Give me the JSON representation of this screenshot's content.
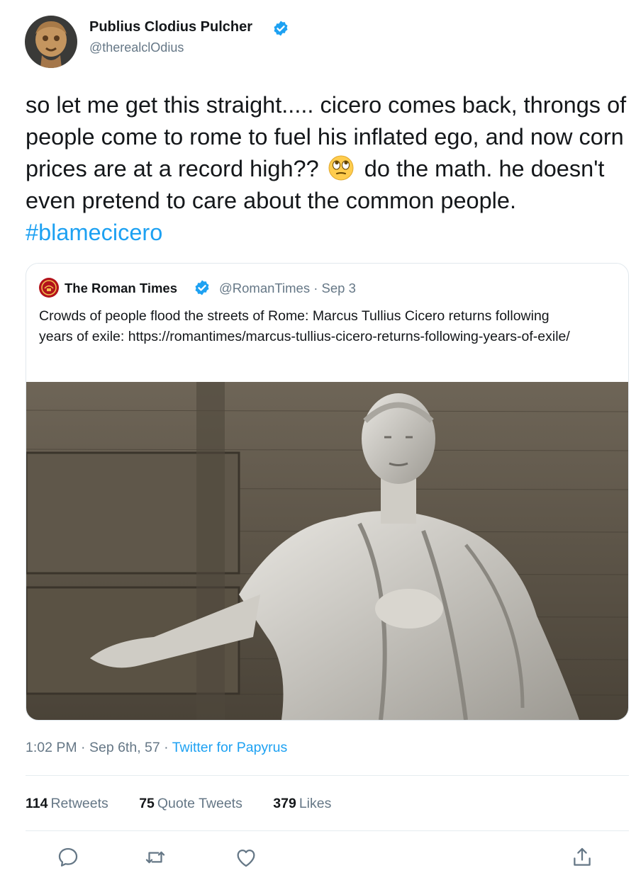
{
  "tweet": {
    "author_name": "Publius Clodius Pulcher",
    "author_handle": "@therealclOdius",
    "text_before_emoji": "so let me get this straight..... cicero comes back, throngs of people come to rome to fuel his inflated ego, and now corn prices are at a record high??",
    "text_after_emoji": "do the math. he doesn't even pretend to care about the common people.",
    "emoji": "face-with-rolling-eyes",
    "hashtag": "#blamecicero",
    "time": "1:02 PM",
    "date": "Sep 6th, 57",
    "source": "Twitter for Papyrus"
  },
  "quoted": {
    "name": "The Roman Times",
    "handle": "@RomanTimes",
    "date": "Sep 3",
    "text": "Crowds of people flood the streets of Rome: Marcus Tullius Cicero returns following years of exile: https://romantimes/marcus-tullius-cicero-returns-following-years-of-exile/"
  },
  "stats": [
    {
      "count": "114",
      "label": "Retweets"
    },
    {
      "count": "75",
      "label": "Quote Tweets"
    },
    {
      "count": "379",
      "label": "Likes"
    }
  ],
  "actions": [
    "reply-icon",
    "retweet-icon",
    "like-icon",
    "share-icon"
  ],
  "colors": {
    "accent": "#1da1f2",
    "text": "#14171a",
    "muted": "#657786",
    "border": "#e1e8ed"
  }
}
